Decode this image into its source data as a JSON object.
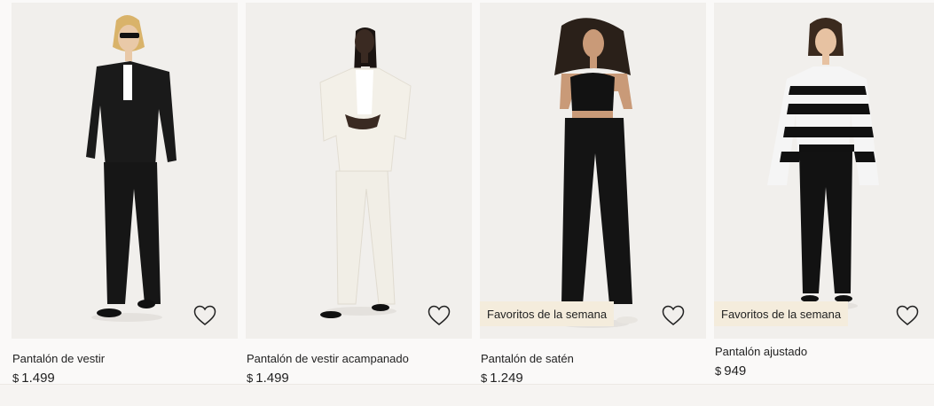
{
  "products": [
    {
      "name": "Pantalón de vestir",
      "currency": "$",
      "price": "1.499",
      "badge": "",
      "favorite_icon": "heart-outline-icon",
      "colors": {
        "top": "#1a1a1a",
        "pants": "#161616",
        "shirt": "#ffffff",
        "skin": "#e9c9a8",
        "hair": "#d9b36a"
      }
    },
    {
      "name": "Pantalón de vestir acampanado",
      "currency": "$",
      "price": "1.499",
      "badge": "",
      "favorite_icon": "heart-outline-icon",
      "colors": {
        "top": "#f3f0e8",
        "pants": "#f1eee6",
        "shirt": "#ffffff",
        "skin": "#3a2a22",
        "hair": "#1b1411"
      }
    },
    {
      "name": "Pantalón de satén",
      "currency": "$",
      "price": "1.249",
      "badge": "Favoritos de la semana",
      "favorite_icon": "heart-outline-icon",
      "colors": {
        "top": "#121212",
        "pants": "#141414",
        "shirt": "#121212",
        "skin": "#c99a78",
        "hair": "#2a2019"
      }
    },
    {
      "name": "Pantalón ajustado",
      "currency": "$",
      "price": "949",
      "badge": "Favoritos de la semana",
      "favorite_icon": "heart-outline-icon",
      "colors": {
        "top": "#111111",
        "pants": "#121212",
        "shirt": "#f5f5f5",
        "skin": "#e7c2a2",
        "hair": "#3b2a1e"
      }
    }
  ]
}
